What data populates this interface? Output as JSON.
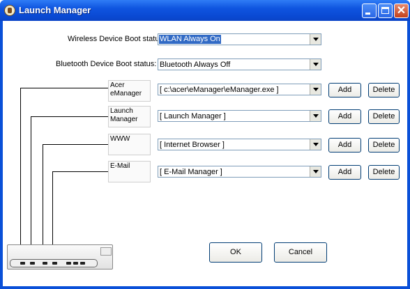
{
  "window": {
    "title": "Launch Manager",
    "title_icon": "launch-manager-icon"
  },
  "wireless": {
    "label": "Wireless Device Boot status:",
    "value": "WLAN Always On"
  },
  "bluetooth": {
    "label": "Bluetooth Device Boot status:",
    "value": "Bluetooth Always Off"
  },
  "apps": [
    {
      "label": "Acer eManager",
      "value": "[ c:\\acer\\eManager\\eManager.exe ]",
      "add": "Add",
      "delete": "Delete"
    },
    {
      "label": "Launch Manager",
      "value": "[ Launch Manager ]",
      "add": "Add",
      "delete": "Delete"
    },
    {
      "label": "WWW",
      "value": "[ Internet Browser ]",
      "add": "Add",
      "delete": "Delete"
    },
    {
      "label": "E-Mail",
      "value": "[ E-Mail Manager ]",
      "add": "Add",
      "delete": "Delete"
    }
  ],
  "footer": {
    "ok": "OK",
    "cancel": "Cancel"
  },
  "colors": {
    "title_bar": "#0a50d8",
    "selection": "#316ac5"
  }
}
